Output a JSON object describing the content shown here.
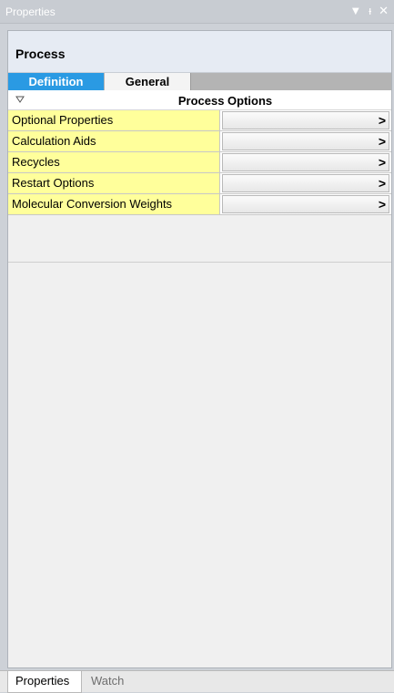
{
  "window": {
    "title": "Properties",
    "controls": {
      "dropdown": "▼",
      "pin": "ᵻ",
      "close": "✕"
    }
  },
  "panel": {
    "title": "Process",
    "tabs": [
      {
        "label": "Definition",
        "active": true
      },
      {
        "label": "General",
        "active": false
      }
    ],
    "section": {
      "label": "Process Options",
      "expanded": true
    },
    "rows": [
      {
        "label": "Optional Properties",
        "value": ">"
      },
      {
        "label": "Calculation Aids",
        "value": ">"
      },
      {
        "label": "Recycles",
        "value": ">"
      },
      {
        "label": "Restart Options",
        "value": ">"
      },
      {
        "label": "Molecular Conversion Weights",
        "value": ">"
      }
    ]
  },
  "bottom_tabs": [
    {
      "label": "Properties",
      "active": true
    },
    {
      "label": "Watch",
      "active": false
    }
  ],
  "colors": {
    "active_tab": "#2a9ae3",
    "property_name_bg": "#ffff9b",
    "header_bg": "#e6ebf3"
  }
}
